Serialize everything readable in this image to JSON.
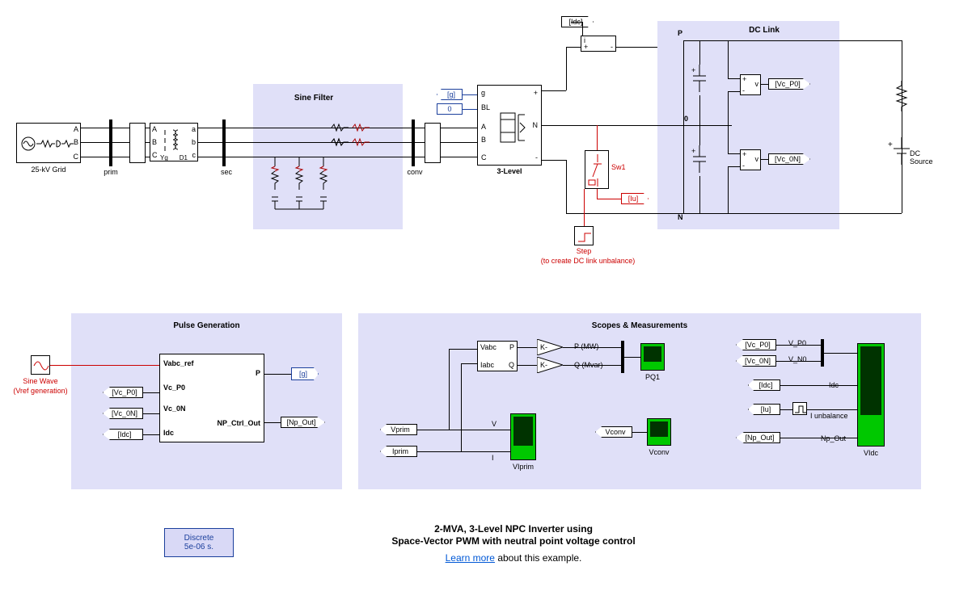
{
  "main": {
    "grid_label": "25-kV Grid",
    "prim_label": "prim",
    "sec_label": "sec",
    "conv_label": "conv",
    "sine_filter_title": "Sine Filter",
    "three_level_label": "3-Level",
    "port_A": "A",
    "port_B": "B",
    "port_C": "C",
    "port_a": "a",
    "port_b": "b",
    "port_c": "c",
    "port_g": "g",
    "port_BL": "BL",
    "port_plus": "+",
    "port_N": "N",
    "port_minus": "-",
    "sw1_label": "Sw1",
    "step_label": "Step",
    "step_note": "(to create DC link unbalance)",
    "dc_link_title": "DC Link",
    "dc_link_P": "P",
    "dc_link_0": "0",
    "dc_link_N": "N",
    "dc_source_label": "DC\nSource",
    "tag_Idc": "[Idc]",
    "tag_g": "[g]",
    "tag_0": "0",
    "tag_Iu": "[Iu]",
    "tag_Vc_P0": "[Vc_P0]",
    "tag_Vc_0N": "[Vc_0N]",
    "xfmr_Yg": "Yg",
    "xfmr_D1": "D1",
    "meas_i": "i",
    "meas_v": "v",
    "meas_plus": "+",
    "meas_minus": "-"
  },
  "pulse": {
    "title": "Pulse Generation",
    "sine_wave_label": "Sine Wave",
    "sine_wave_note": "(Vref generation)",
    "in_Vabc": "Vabc_ref",
    "in_VcP0": "Vc_P0",
    "in_Vc0N": "Vc_0N",
    "in_Idc": "Idc",
    "out_P": "P",
    "out_NP": "NP_Ctrl_Out",
    "tag_VcP0": "[Vc_P0]",
    "tag_Vc0N": "[Vc_0N]",
    "tag_Idc": "[Idc]",
    "tag_g": "[g]",
    "tag_NpOut": "[Np_Out]"
  },
  "scopes": {
    "title": "Scopes & Measurements",
    "Vprim": "Vprim",
    "Iprim": "Iprim",
    "V": "V",
    "I": "I",
    "VIprim": "VIprim",
    "Vabc": "Vabc",
    "Iabc": "Iabc",
    "P": "P",
    "Q": "Q",
    "P_MW": "P (MW)",
    "Q_Mvar": "Q (Mvar)",
    "PQ1": "PQ1",
    "Vconv_tag": "Vconv",
    "Vconv_scope": "Vconv",
    "K": "K-",
    "Vc_P0": "[Vc_P0]",
    "Vc_0N": "[Vc_0N]",
    "Idc": "[Idc]",
    "Iu": "[Iu]",
    "NpOut": "[Np_Out]",
    "lbl_VP0": "V_P0",
    "lbl_VN0": "V_N0",
    "lbl_Idc": "Idc",
    "lbl_Iunb": "I unbalance",
    "lbl_NpOut": "Np_Out",
    "VIdc": "VIdc"
  },
  "footer": {
    "powergui_l1": "Discrete",
    "powergui_l2": "5e-06 s.",
    "title_l1": "2-MVA, 3-Level NPC Inverter using",
    "title_l2": "Space-Vector PWM with neutral point voltage control",
    "learn_more": "Learn more",
    "learn_more_suffix": " about this example."
  }
}
